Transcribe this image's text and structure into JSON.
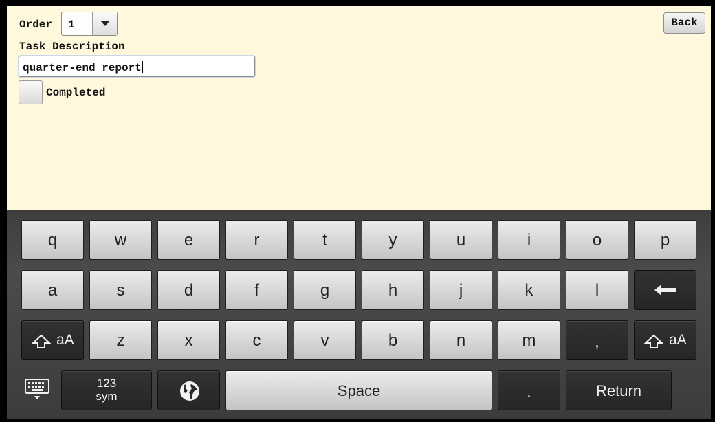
{
  "form": {
    "order_label": "Order",
    "order_value": "1",
    "task_description_label": "Task Description",
    "task_description_value": "quarter-end report",
    "completed_label": "Completed",
    "completed_checked": false,
    "back_label": "Back"
  },
  "keyboard": {
    "row1": [
      "q",
      "w",
      "e",
      "r",
      "t",
      "y",
      "u",
      "i",
      "o",
      "p"
    ],
    "row2": [
      "a",
      "s",
      "d",
      "f",
      "g",
      "h",
      "j",
      "k",
      "l"
    ],
    "row3": [
      "z",
      "x",
      "c",
      "v",
      "b",
      "n",
      "m"
    ],
    "shift_label": "aA",
    "comma": ",",
    "period": ".",
    "sym_line1": "123",
    "sym_line2": "sym",
    "space_label": "Space",
    "return_label": "Return",
    "icons": {
      "backspace": "backspace-arrow-icon",
      "shift": "shift-arrow-icon",
      "hide_keyboard": "keyboard-hide-icon",
      "language": "globe-icon",
      "dropdown": "chevron-down-icon"
    }
  }
}
